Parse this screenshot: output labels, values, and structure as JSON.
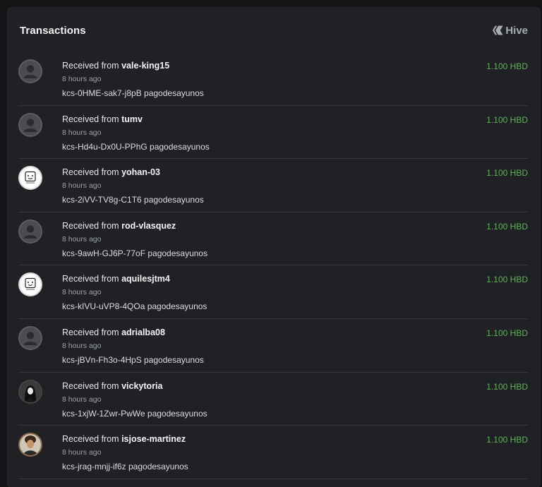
{
  "header": {
    "title": "Transactions",
    "brand": "Hive"
  },
  "colors": {
    "background": "#141517",
    "panel": "#1f2124",
    "amount_green": "#5fb35a",
    "divider": "#34363a"
  },
  "transactions": [
    {
      "prefix": "Received from",
      "user": "vale-king15",
      "time": "8 hours ago",
      "memo": "kcs-0HME-sak7-j8pB pagodesayunos",
      "amount": "1.100 HBD",
      "avatar": "default-user-icon"
    },
    {
      "prefix": "Received from",
      "user": "tumv",
      "time": "8 hours ago",
      "memo": "kcs-Hd4u-Dx0U-PPhG pagodesayunos",
      "amount": "1.100 HBD",
      "avatar": "default-user-icon"
    },
    {
      "prefix": "Received from",
      "user": "yohan-03",
      "time": "8 hours ago",
      "memo": "kcs-2iVV-TV8g-C1T6 pagodesayunos",
      "amount": "1.100 HBD",
      "avatar": "robot-face-icon"
    },
    {
      "prefix": "Received from",
      "user": "rod-vlasquez",
      "time": "8 hours ago",
      "memo": "kcs-9awH-GJ6P-77oF pagodesayunos",
      "amount": "1.100 HBD",
      "avatar": "default-user-icon"
    },
    {
      "prefix": "Received from",
      "user": "aquilesjtm4",
      "time": "8 hours ago",
      "memo": "kcs-kIVU-uVP8-4QOa pagodesayunos",
      "amount": "1.100 HBD",
      "avatar": "robot-face-icon"
    },
    {
      "prefix": "Received from",
      "user": "adrialba08",
      "time": "8 hours ago",
      "memo": "kcs-jBVn-Fh3o-4HpS pagodesayunos",
      "amount": "1.100 HBD",
      "avatar": "default-user-icon"
    },
    {
      "prefix": "Received from",
      "user": "vickytoria",
      "time": "8 hours ago",
      "memo": "kcs-1xjW-1Zwr-PwWe pagodesayunos",
      "amount": "1.100 HBD",
      "avatar": "photo-avatar-dark"
    },
    {
      "prefix": "Received from",
      "user": "isjose-martinez",
      "time": "8 hours ago",
      "memo": "kcs-jrag-mnjj-if6z pagodesayunos",
      "amount": "1.100 HBD",
      "avatar": "photo-avatar-warm"
    }
  ]
}
